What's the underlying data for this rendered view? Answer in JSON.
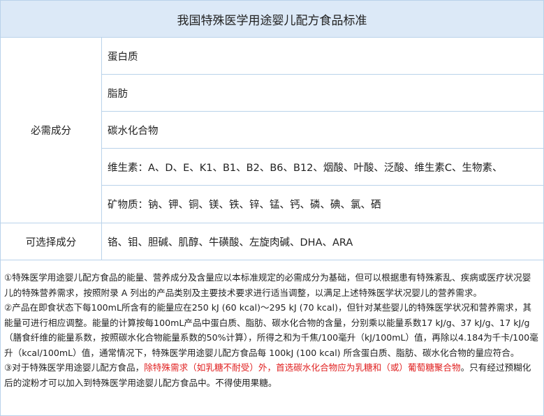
{
  "title": "我国特殊医学用途婴儿配方食品标准",
  "essential": {
    "label": "必需成分",
    "items": [
      "蛋白质",
      "脂肪",
      "碳水化合物",
      "维生素：A、D、E、K1、B1、B2、B6、B12、烟酸、叶酸、泛酸、维生素C、生物素、",
      "矿物质：钠、钾、铜、镁、铁、锌、锰、钙、磷、碘、氯、硒"
    ]
  },
  "optional": {
    "label": "可选择成分",
    "items": "铬、钼、胆碱、肌醇、牛磺酸、左旋肉碱、DHA、ARA"
  },
  "notes": {
    "n1": "①特殊医学用途婴儿配方食品的能量、营养成分及含量应以本标准规定的必需成分为基础，但可以根据患有特殊紊乱、疾病或医疗状况婴儿的特殊营养需求，按照附录 A 列出的产品类别及主要技术要求进行适当调整，以满足上述特殊医学状况婴儿的营养需求。",
    "n2": "②产品在即食状态下每100mL所含有的能量应在250 kJ (60 kcal)～295 kJ (70 kcal)，但针对某些婴儿的特殊医学状况和营养需求，其能量可进行相应调整。能量的计算按每100mL产品中蛋白质、脂肪、碳水化合物的含量，分别乘以能量系数17 kJ/g、37 kJ/g、17 kJ/g（膳食纤维的能量系数，按照碳水化合物能量系数的50%计算），所得之和为千焦/100毫升（kJ/100mL）值，再除以4.184为千卡/100毫升（kcal/100mL）值，通常情况下，特殊医学用途婴儿配方食品每 100kJ (100 kcal) 所含蛋白质、脂肪、碳水化合物的量应符合。",
    "n3_start": "③对于特殊医学用途婴儿配方食品，",
    "n3_red": "除特殊需求（如乳糖不耐受）外，首选碳水化合物应为乳糖和（或）葡萄糖聚合物",
    "n3_end": "。只有经过预糊化后的淀粉才可以加入到特殊医学用途婴儿配方食品中。不得使用果糖。"
  },
  "colors": {
    "header_bg": "#dce9f7",
    "border": "#b9d2ea",
    "highlight": "#e02020"
  }
}
